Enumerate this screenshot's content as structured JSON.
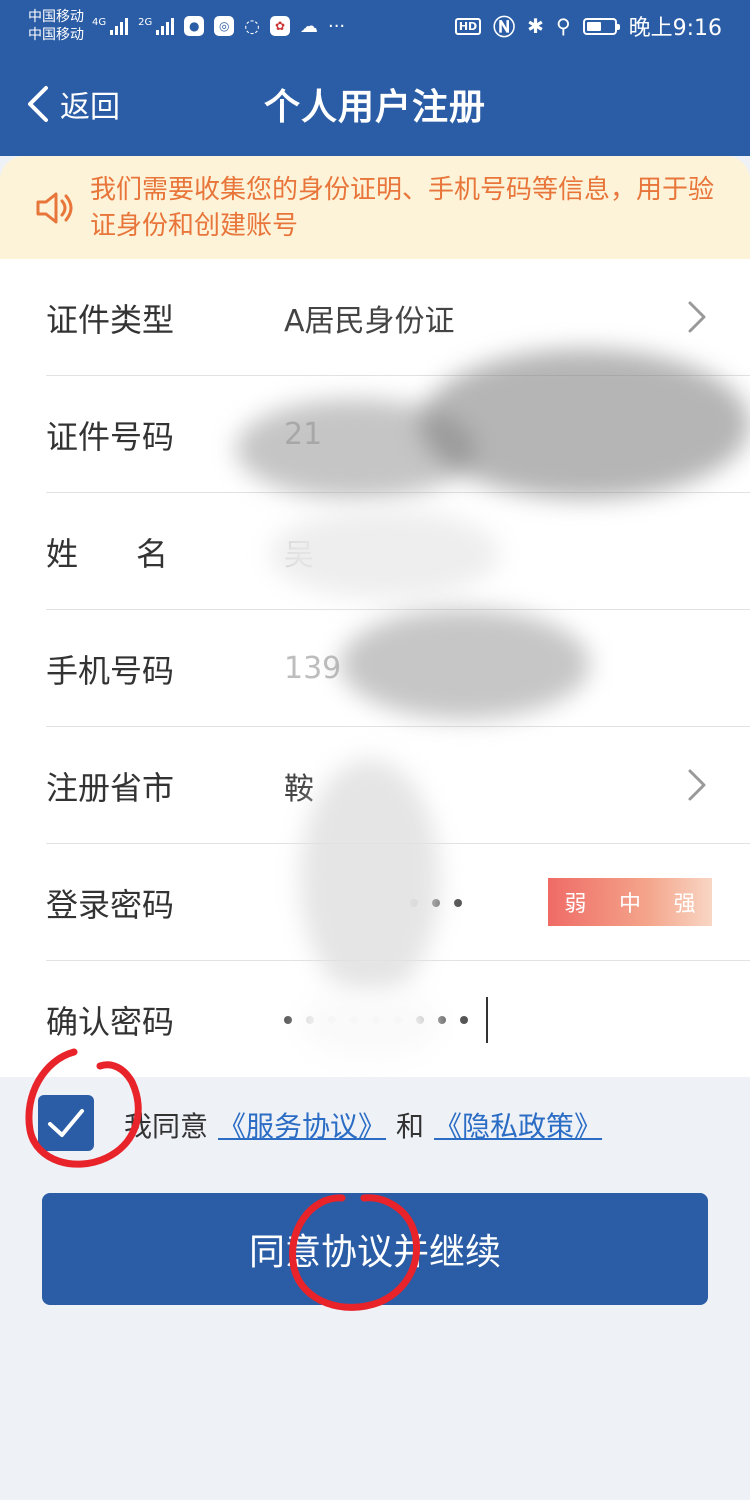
{
  "status_bar": {
    "carrier_1": "中国移动",
    "carrier_2": "中国移动",
    "net_1": "4G",
    "net_2": "2G",
    "hd": "HD",
    "time": "晚上9:16",
    "battery_level": 0.55
  },
  "nav": {
    "back_label": "返回",
    "title": "个人用户注册"
  },
  "notice": {
    "text": "我们需要收集您的身份证明、手机号码等信息，用于验证身份和创建账号"
  },
  "form": {
    "fields": [
      {
        "label": "证件类型",
        "value": "A居民身份证"
      },
      {
        "label": "证件号码",
        "value": "21"
      },
      {
        "label": "姓名",
        "value": "吴"
      },
      {
        "label": "手机号码",
        "value": "139"
      },
      {
        "label": "注册省市",
        "value": "鞍"
      },
      {
        "label": "登录密码",
        "value": ""
      },
      {
        "label": "确认密码",
        "value": ""
      }
    ],
    "strength": {
      "weak": "弱",
      "medium": "中",
      "strong": "强"
    }
  },
  "agreement": {
    "prefix": "我同意",
    "service_link": "《服务协议》",
    "and": "和",
    "privacy_link": "《隐私政策》",
    "checked": true
  },
  "submit_label": "同意协议并继续",
  "colors": {
    "primary": "#2b5da6",
    "notice_bg": "#fdf3d9",
    "notice_text": "#e8753a",
    "annotation": "#e8232a"
  }
}
